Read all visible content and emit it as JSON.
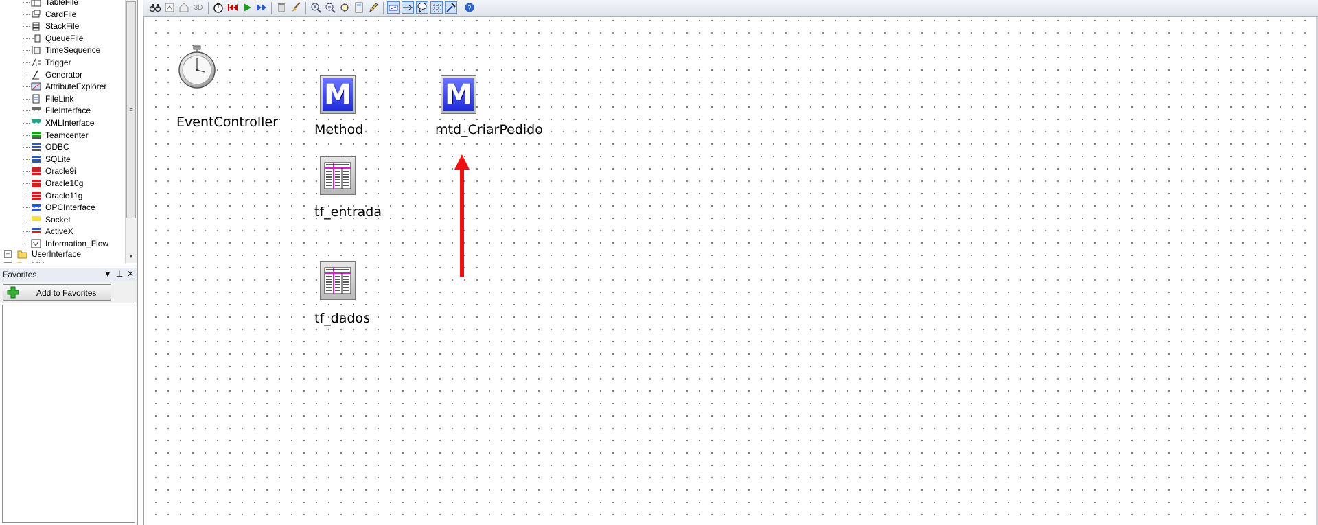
{
  "tree": {
    "items": [
      {
        "label": "TableFile",
        "icon": "tablefile-icon"
      },
      {
        "label": "CardFile",
        "icon": "cardfile-icon"
      },
      {
        "label": "StackFile",
        "icon": "stackfile-icon"
      },
      {
        "label": "QueueFile",
        "icon": "queuefile-icon"
      },
      {
        "label": "TimeSequence",
        "icon": "timesequence-icon"
      },
      {
        "label": "Trigger",
        "icon": "trigger-icon"
      },
      {
        "label": "Generator",
        "icon": "generator-icon"
      },
      {
        "label": "AttributeExplorer",
        "icon": "attributeexplorer-icon"
      },
      {
        "label": "FileLink",
        "icon": "filelink-icon"
      },
      {
        "label": "FileInterface",
        "icon": "fileinterface-icon"
      },
      {
        "label": "XMLInterface",
        "icon": "xmlinterface-icon"
      },
      {
        "label": "Teamcenter",
        "icon": "teamcenter-icon"
      },
      {
        "label": "ODBC",
        "icon": "odbc-icon"
      },
      {
        "label": "SQLite",
        "icon": "sqlite-icon"
      },
      {
        "label": "Oracle9i",
        "icon": "oracle-icon"
      },
      {
        "label": "Oracle10g",
        "icon": "oracle-icon"
      },
      {
        "label": "Oracle11g",
        "icon": "oracle-icon"
      },
      {
        "label": "OPCInterface",
        "icon": "opcinterface-icon"
      },
      {
        "label": "Socket",
        "icon": "socket-icon"
      },
      {
        "label": "ActiveX",
        "icon": "activex-icon"
      },
      {
        "label": "Information_Flow",
        "icon": "information-flow-icon"
      }
    ],
    "folders": [
      {
        "label": "UserInterface",
        "icon": "folder-icon"
      },
      {
        "label": "MU",
        "icon": "folder-icon"
      }
    ]
  },
  "favorites": {
    "title": "Favorites",
    "add_button_label": "Add to Favorites"
  },
  "canvas": {
    "objects": [
      {
        "label": "EventController",
        "kind": "event-controller"
      },
      {
        "label": "Method",
        "kind": "method",
        "glyph": "M"
      },
      {
        "label": "mtd_CriarPedido",
        "kind": "method",
        "glyph": "M"
      },
      {
        "label": "tf_entrada",
        "kind": "table-file"
      },
      {
        "label": "tf_dados",
        "kind": "table-file"
      }
    ],
    "annotation_color": "#ee1111"
  },
  "colors": {
    "method_blue": "#2a36e0",
    "table_magenta": "#d61fd6"
  }
}
